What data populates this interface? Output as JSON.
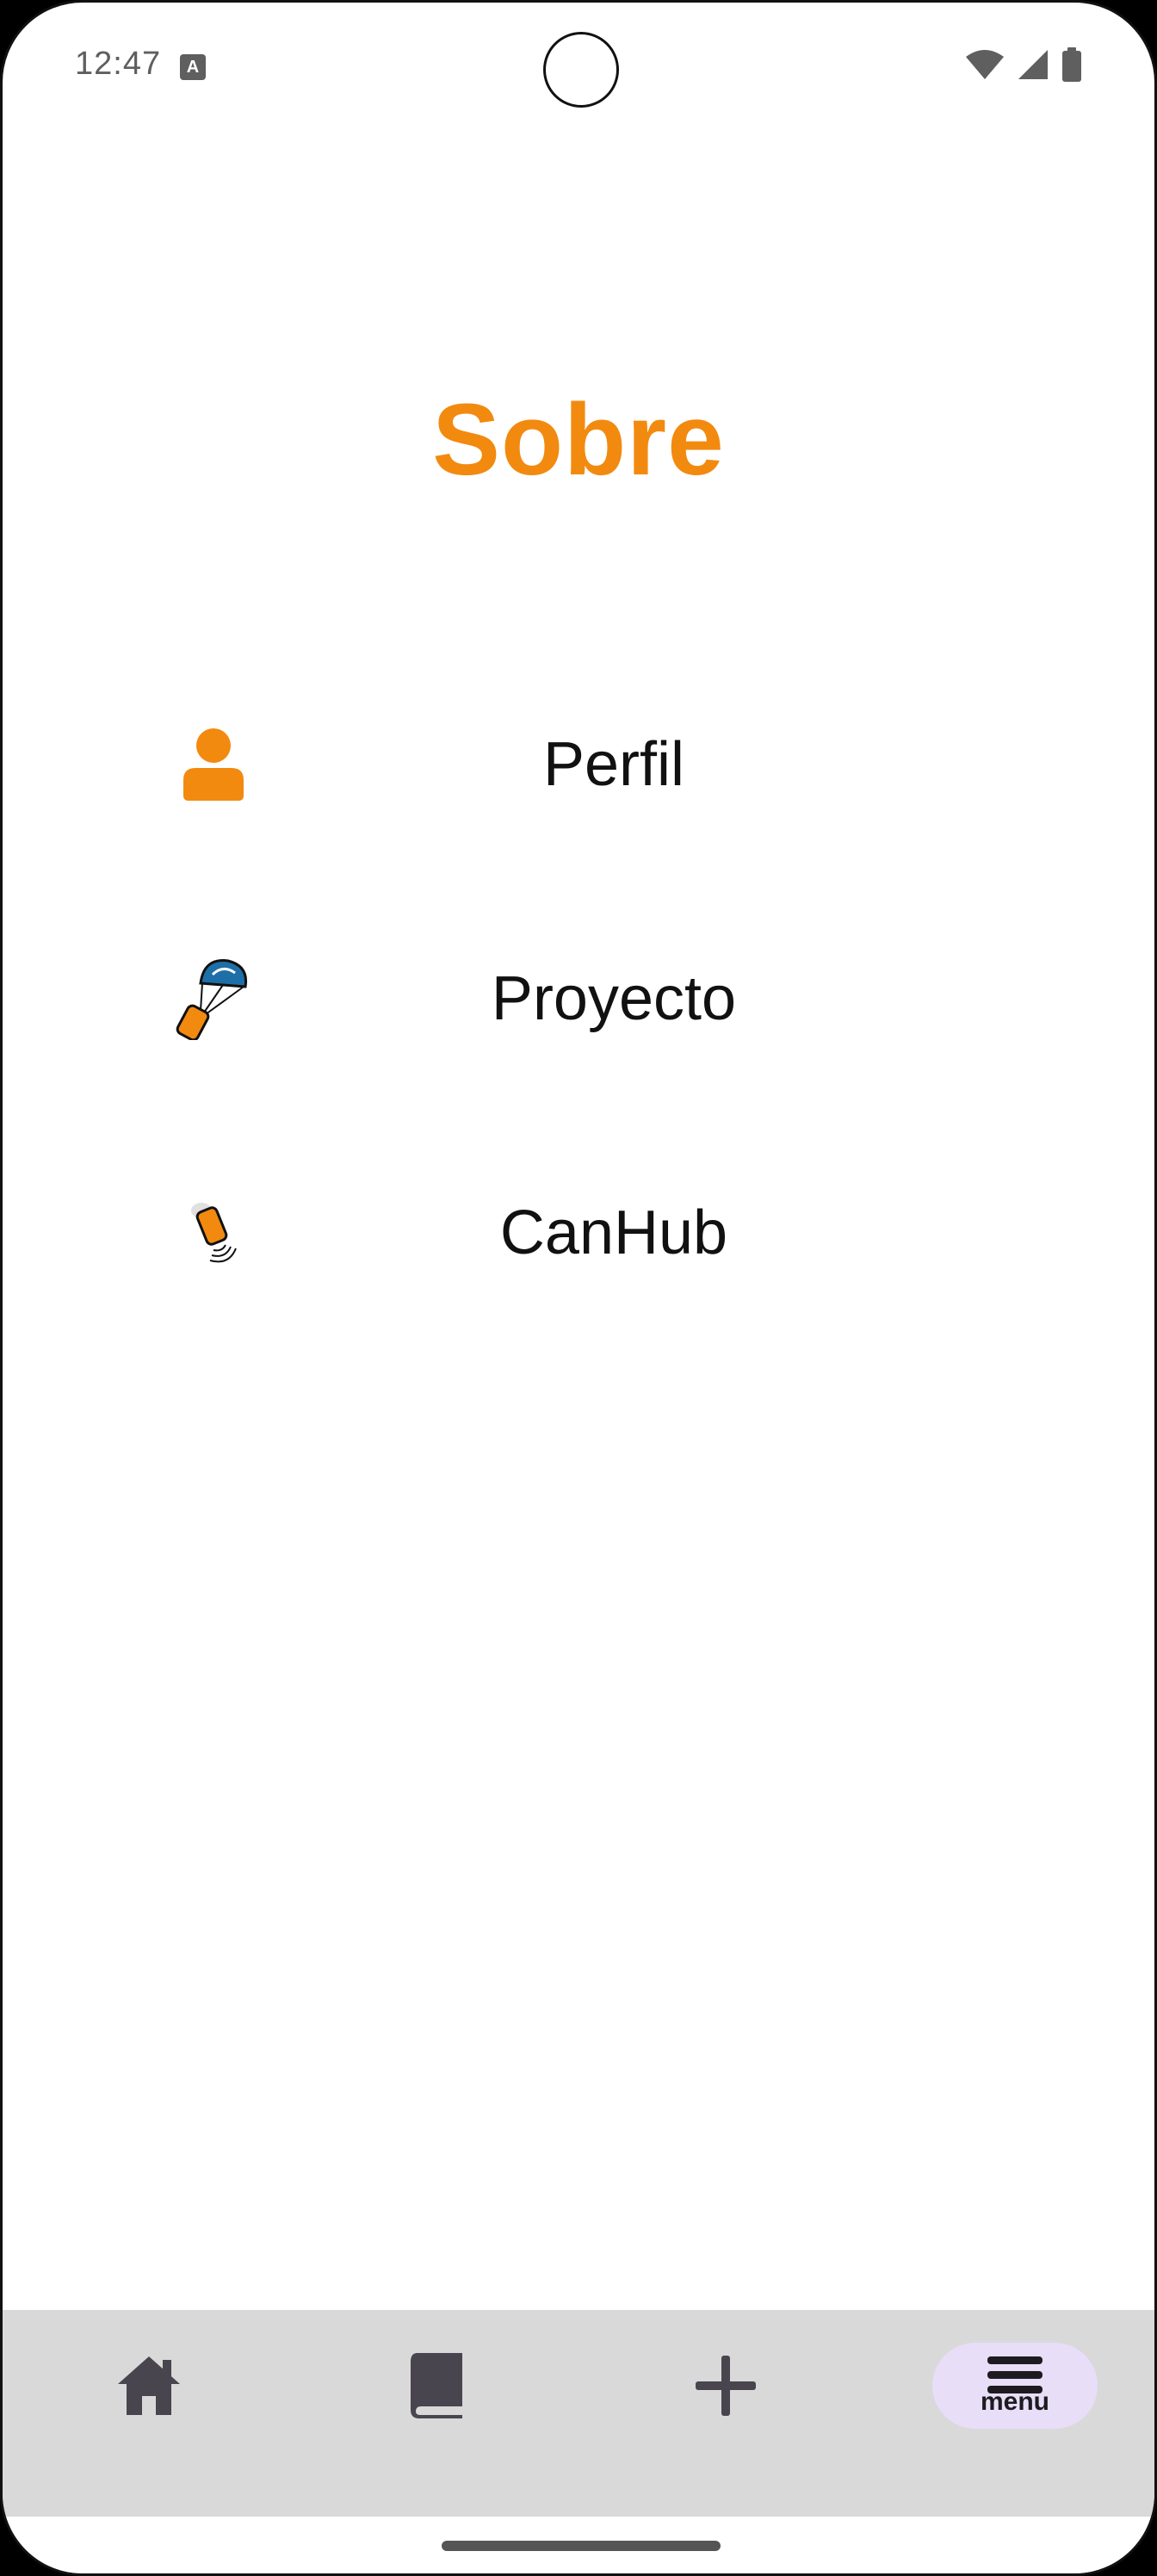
{
  "status_bar": {
    "time": "12:47",
    "notification_icon": "A"
  },
  "page": {
    "title": "Sobre"
  },
  "menu": {
    "items": [
      {
        "label": "Perfil",
        "icon": "person-icon"
      },
      {
        "label": "Proyecto",
        "icon": "parachute-can-icon"
      },
      {
        "label": "CanHub",
        "icon": "can-signal-icon"
      }
    ]
  },
  "bottom_nav": {
    "items": [
      {
        "icon": "home-icon"
      },
      {
        "icon": "book-icon"
      },
      {
        "icon": "plus-icon"
      },
      {
        "icon": "menu-icon",
        "label": "menu",
        "active": true
      }
    ]
  },
  "colors": {
    "accent": "#f28a0f",
    "nav_background": "#d9d9d9",
    "nav_active": "#e8def8"
  }
}
